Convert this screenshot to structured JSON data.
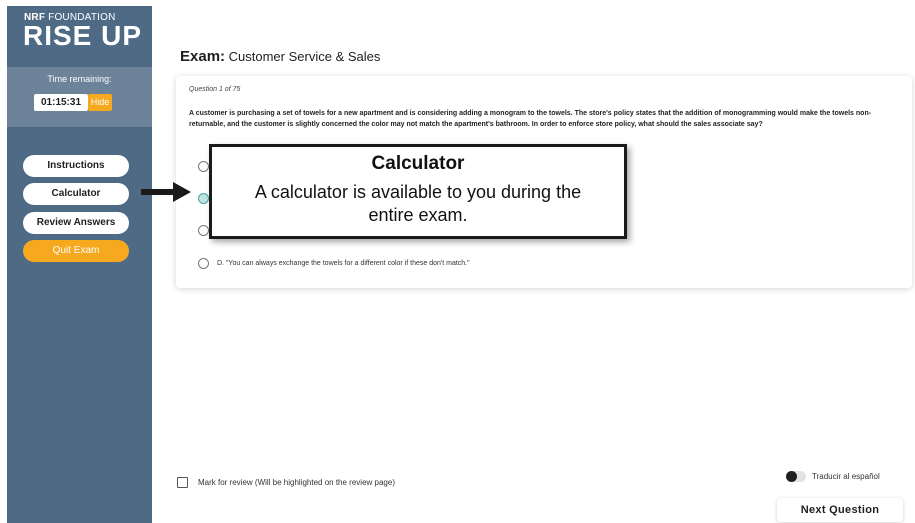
{
  "sidebar": {
    "brand_org_bold": "NRF",
    "brand_org_rest": " FOUNDATION",
    "brand_title": "RISE UP",
    "time_label": "Time remaining:",
    "time_value": "01:15:31",
    "hide_label": "Hide",
    "nav": {
      "instructions": "Instructions",
      "calculator": "Calculator",
      "review_answers": "Review Answers",
      "quit_exam": "Quit Exam"
    },
    "colors": {
      "background": "#4e6a84",
      "panel": "#6c8399",
      "accent": "#f6a91f"
    }
  },
  "exam": {
    "title_prefix": "Exam:",
    "title_name": " Customer Service & Sales",
    "question_number": "Question 1 of 75",
    "question_text": "A customer is purchasing a set of towels for a new apartment and is considering adding a monogram to the towels. The store's policy states that the addition of monogramming would make the towels non-returnable, and the customer is slightly concerned the color may not match the apartment's bathroom. In order to enforce store policy, what should the sales associate say?",
    "options": {
      "a": "",
      "b": "",
      "c": "",
      "d": "D. \"You can always exchange the towels for a different color if these don't match.\""
    },
    "selected_option": "b"
  },
  "callout": {
    "title": "Calculator",
    "body": "A calculator is available to you during the entire exam."
  },
  "footer": {
    "mark_review_label": "Mark for review (Will be highlighted on the review page)",
    "translate_label": "Traducir al español",
    "next_label": "Next Question"
  },
  "icons": {
    "pointer": "arrow-right-icon",
    "translate_toggle": "toggle-switch-icon"
  }
}
